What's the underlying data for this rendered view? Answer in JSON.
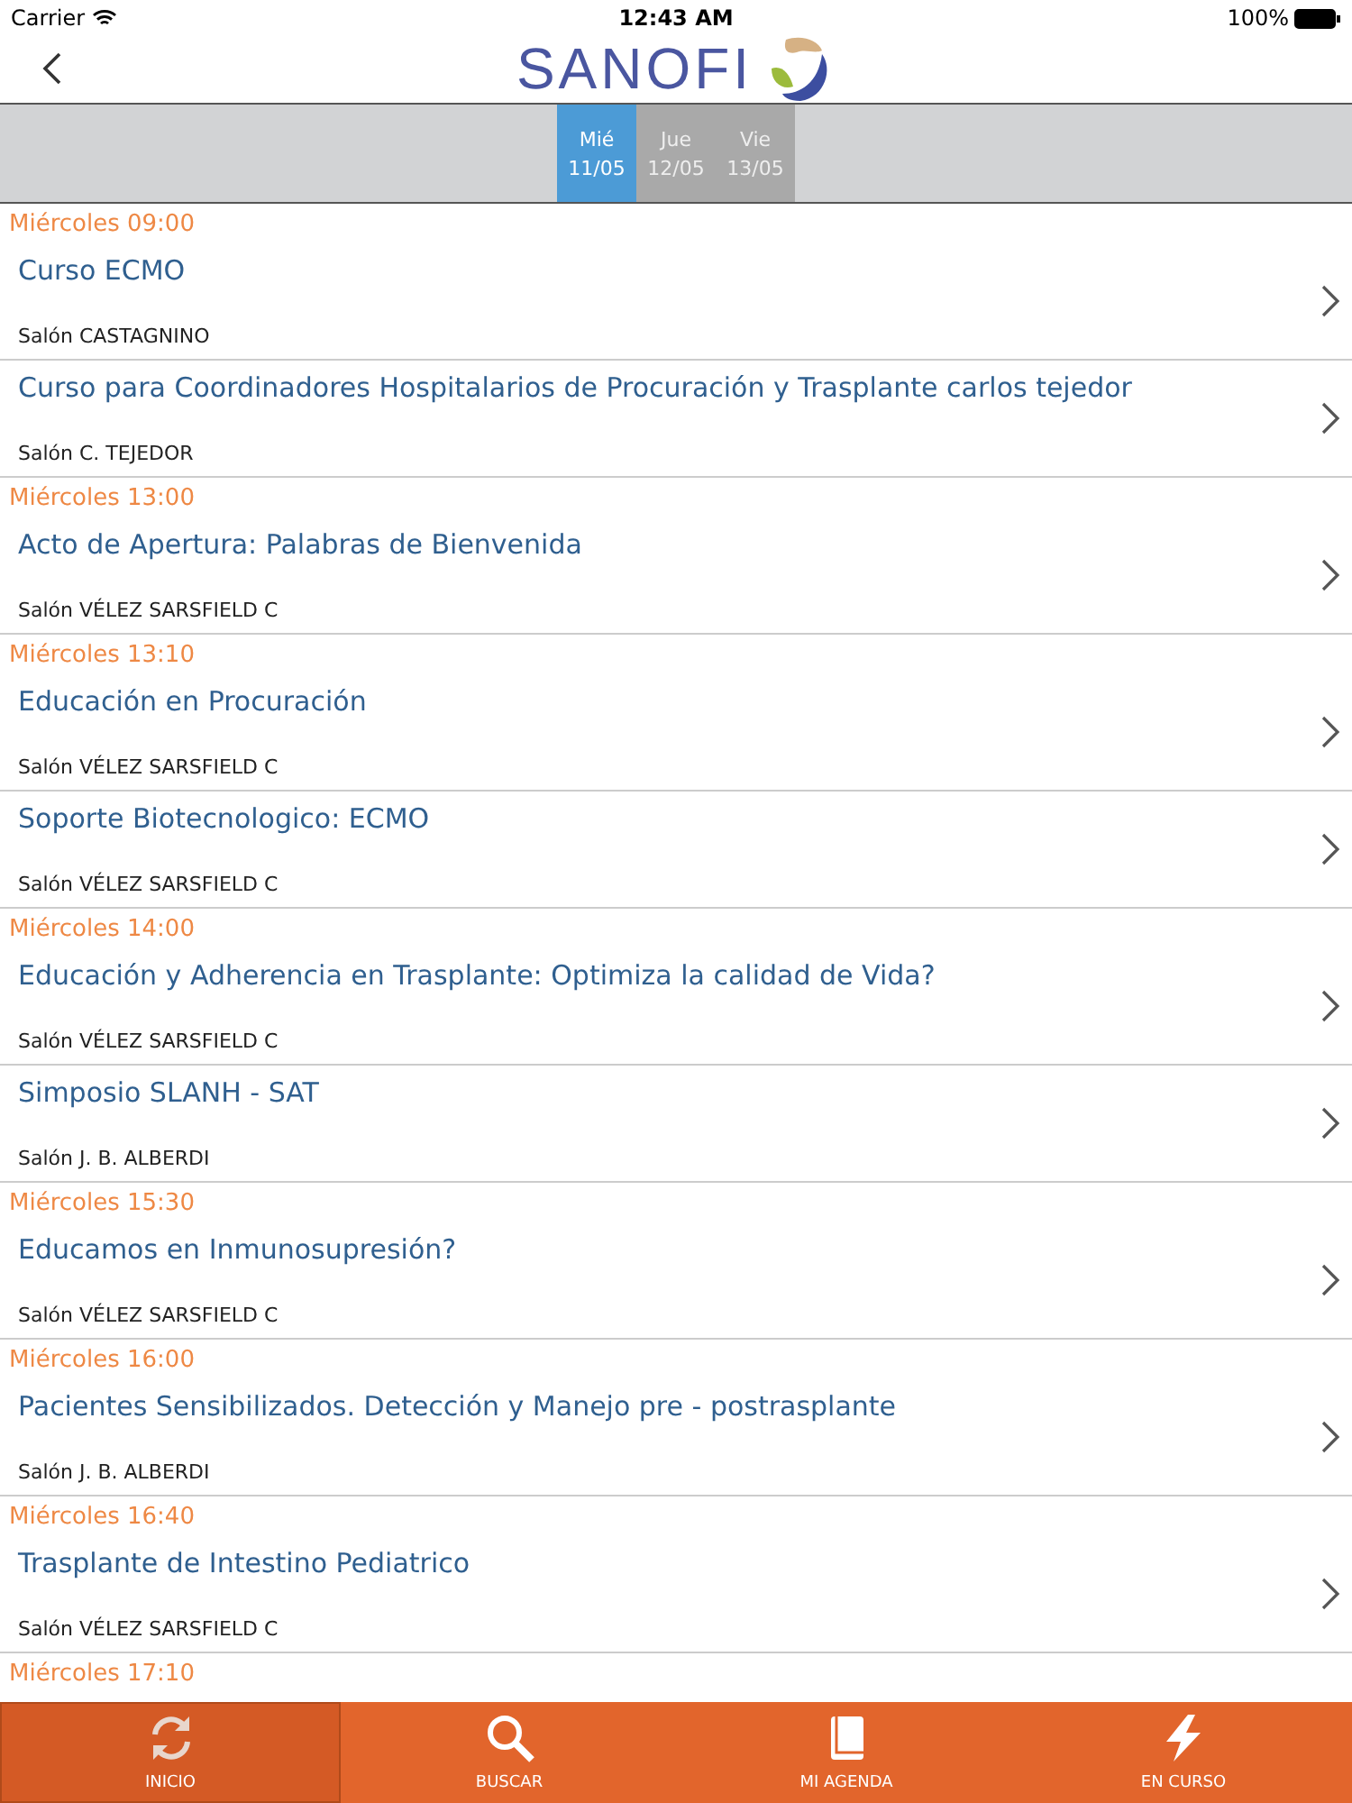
{
  "status_bar": {
    "carrier": "Carrier",
    "time": "12:43 AM",
    "battery": "100%"
  },
  "nav": {
    "logo": "SANOFI"
  },
  "days": [
    {
      "name": "Mié",
      "date": "11/05",
      "selected": true
    },
    {
      "name": "Jue",
      "date": "12/05",
      "selected": false
    },
    {
      "name": "Vie",
      "date": "13/05",
      "selected": false
    }
  ],
  "groups": [
    {
      "time": "Miércoles 09:00",
      "sessions": [
        {
          "title": "Curso ECMO",
          "room": "Salón CASTAGNINO"
        },
        {
          "title": "Curso para Coordinadores Hospitalarios de Procuración y Trasplante carlos tejedor",
          "room": "Salón C. TEJEDOR"
        }
      ]
    },
    {
      "time": "Miércoles 13:00",
      "sessions": [
        {
          "title": "Acto de Apertura: Palabras de Bienvenida",
          "room": "Salón VÉLEZ SARSFIELD C"
        }
      ]
    },
    {
      "time": "Miércoles 13:10",
      "sessions": [
        {
          "title": "Educación en Procuración",
          "room": "Salón VÉLEZ SARSFIELD C"
        },
        {
          "title": "Soporte Biotecnologico: ECMO",
          "room": "Salón VÉLEZ SARSFIELD C"
        }
      ]
    },
    {
      "time": "Miércoles 14:00",
      "sessions": [
        {
          "title": "Educación y Adherencia en Trasplante: Optimiza la calidad de Vida?",
          "room": "Salón VÉLEZ SARSFIELD C"
        },
        {
          "title": "Simposio SLANH - SAT",
          "room": "Salón J. B. ALBERDI"
        }
      ]
    },
    {
      "time": "Miércoles 15:30",
      "sessions": [
        {
          "title": "Educamos en Inmunosupresión?",
          "room": "Salón VÉLEZ SARSFIELD C"
        }
      ]
    },
    {
      "time": "Miércoles 16:00",
      "sessions": [
        {
          "title": "Pacientes Sensibilizados. Detección y Manejo pre - postrasplante",
          "room": "Salón J. B. ALBERDI"
        }
      ]
    },
    {
      "time": "Miércoles 16:40",
      "sessions": [
        {
          "title": "Trasplante de Intestino Pediatrico",
          "room": "Salón VÉLEZ SARSFIELD C"
        }
      ]
    },
    {
      "time": "Miércoles 17:10"
    }
  ],
  "tabs": [
    {
      "label": "INICIO",
      "kind": "refresh",
      "selected": true
    },
    {
      "label": "BUSCAR",
      "kind": "search",
      "selected": false
    },
    {
      "label": "MI AGENDA",
      "kind": "book",
      "selected": false
    },
    {
      "label": "EN CURSO",
      "kind": "bolt",
      "selected": false
    }
  ]
}
